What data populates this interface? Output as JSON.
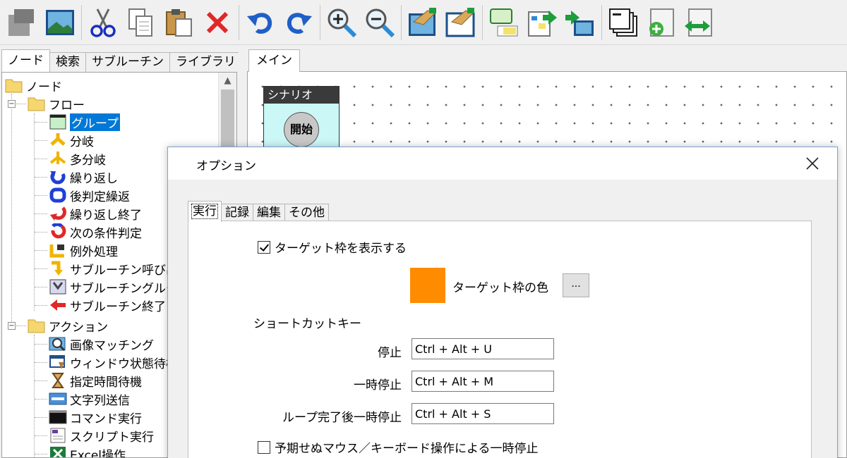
{
  "toolbar": {
    "buttons": [
      {
        "name": "new-icon"
      },
      {
        "name": "image-icon"
      },
      {
        "name": "cut-icon"
      },
      {
        "name": "copy-icon"
      },
      {
        "name": "paste-icon"
      },
      {
        "name": "delete-icon"
      },
      {
        "name": "undo-icon"
      },
      {
        "name": "redo-icon"
      },
      {
        "name": "zoom-in-icon"
      },
      {
        "name": "zoom-out-icon"
      },
      {
        "name": "capture-icon"
      },
      {
        "name": "capture-window-icon"
      },
      {
        "name": "comment-icon"
      },
      {
        "name": "export-icon"
      },
      {
        "name": "import-icon"
      },
      {
        "name": "windows-icon"
      },
      {
        "name": "add-icon"
      },
      {
        "name": "move-icon"
      }
    ]
  },
  "left_tabs": [
    "ノード",
    "検索",
    "サブルーチン",
    "ライブラリ"
  ],
  "tree": {
    "root": "ノード",
    "flow_folder": "フロー",
    "flow_items": [
      "グループ",
      "分岐",
      "多分岐",
      "繰り返し",
      "後判定繰返",
      "繰り返し終了",
      "次の条件判定",
      "例外処理",
      "サブルーチン呼び出",
      "サブルーチングルー",
      "サブルーチン終了"
    ],
    "action_folder": "アクション",
    "action_items": [
      "画像マッチング",
      "ウィンドウ状態待機",
      "指定時間待機",
      "文字列送信",
      "コマンド実行",
      "スクリプト実行",
      "Excel操作"
    ]
  },
  "main_tab": "メイン",
  "scenario": {
    "title": "シナリオ",
    "start": "開始"
  },
  "dialog": {
    "title": "オプション",
    "tabs": [
      "実行",
      "記録",
      "編集",
      "その他"
    ],
    "show_target_frame": "ターゲット枠を表示する",
    "target_color_label": "ターゲット枠の色",
    "target_color": "#ff8c00",
    "color_button": "...",
    "shortcut_heading": "ショートカットキー",
    "shortcuts": [
      {
        "label": "停止",
        "value": "Ctrl + Alt + U"
      },
      {
        "label": "一時停止",
        "value": "Ctrl + Alt + M"
      },
      {
        "label": "ループ完了後一時停止",
        "value": "Ctrl + Alt + S"
      }
    ],
    "pause_on_input": "予期せぬマウス／キーボード操作による一時停止"
  }
}
